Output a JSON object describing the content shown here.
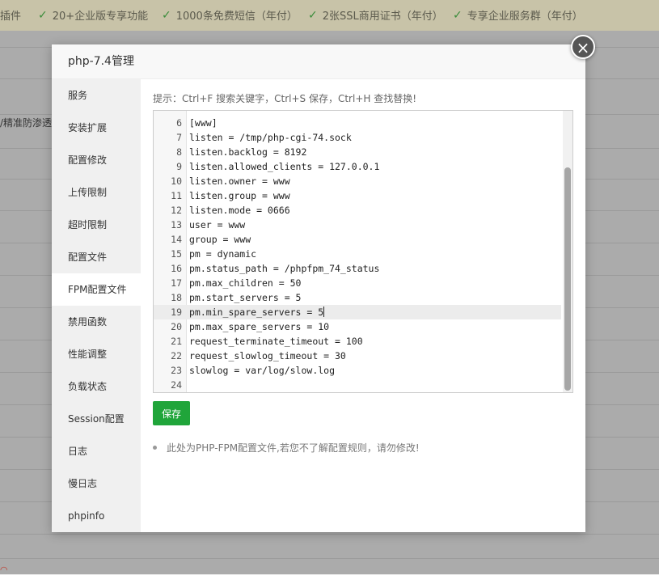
{
  "background": {
    "banner_items": [
      "插件",
      "20+企业版专享功能",
      "1000条免费短信（年付）",
      "2张SSL商用证书（年付）",
      "专享企业服务群（年付）"
    ],
    "left_text": "/精准防渗透"
  },
  "modal": {
    "title": "php-7.4管理",
    "close_icon": "×"
  },
  "sidebar": {
    "items": [
      {
        "label": "服务"
      },
      {
        "label": "安装扩展"
      },
      {
        "label": "配置修改"
      },
      {
        "label": "上传限制"
      },
      {
        "label": "超时限制"
      },
      {
        "label": "配置文件"
      },
      {
        "label": "FPM配置文件",
        "active": true
      },
      {
        "label": "禁用函数"
      },
      {
        "label": "性能调整"
      },
      {
        "label": "负载状态"
      },
      {
        "label": "Session配置"
      },
      {
        "label": "日志"
      },
      {
        "label": "慢日志"
      },
      {
        "label": "phpinfo"
      }
    ]
  },
  "content": {
    "tip": "提示：Ctrl+F 搜索关键字，Ctrl+S 保存，Ctrl+H 查找替换!",
    "editor": {
      "active_line": 19,
      "lines": [
        {
          "n": "6",
          "t": "[www]"
        },
        {
          "n": "7",
          "t": "listen = /tmp/php-cgi-74.sock"
        },
        {
          "n": "8",
          "t": "listen.backlog = 8192"
        },
        {
          "n": "9",
          "t": "listen.allowed_clients = 127.0.0.1"
        },
        {
          "n": "10",
          "t": "listen.owner = www"
        },
        {
          "n": "11",
          "t": "listen.group = www"
        },
        {
          "n": "12",
          "t": "listen.mode = 0666"
        },
        {
          "n": "13",
          "t": "user = www"
        },
        {
          "n": "14",
          "t": "group = www"
        },
        {
          "n": "15",
          "t": "pm = dynamic"
        },
        {
          "n": "16",
          "t": "pm.status_path = /phpfpm_74_status"
        },
        {
          "n": "17",
          "t": "pm.max_children = 50"
        },
        {
          "n": "18",
          "t": "pm.start_servers = 5"
        },
        {
          "n": "19",
          "t": "pm.min_spare_servers = 5"
        },
        {
          "n": "20",
          "t": "pm.max_spare_servers = 10"
        },
        {
          "n": "21",
          "t": "request_terminate_timeout = 100"
        },
        {
          "n": "22",
          "t": "request_slowlog_timeout = 30"
        },
        {
          "n": "23",
          "t": "slowlog = var/log/slow.log"
        },
        {
          "n": "24",
          "t": ""
        }
      ]
    },
    "save_label": "保存",
    "note": "此处为PHP-FPM配置文件,若您不了解配置规则，请勿修改!"
  },
  "colors": {
    "accent": "#20a53a",
    "sidebar_bg": "#f0f0f0",
    "banner_bg": "#c8c3a8"
  }
}
